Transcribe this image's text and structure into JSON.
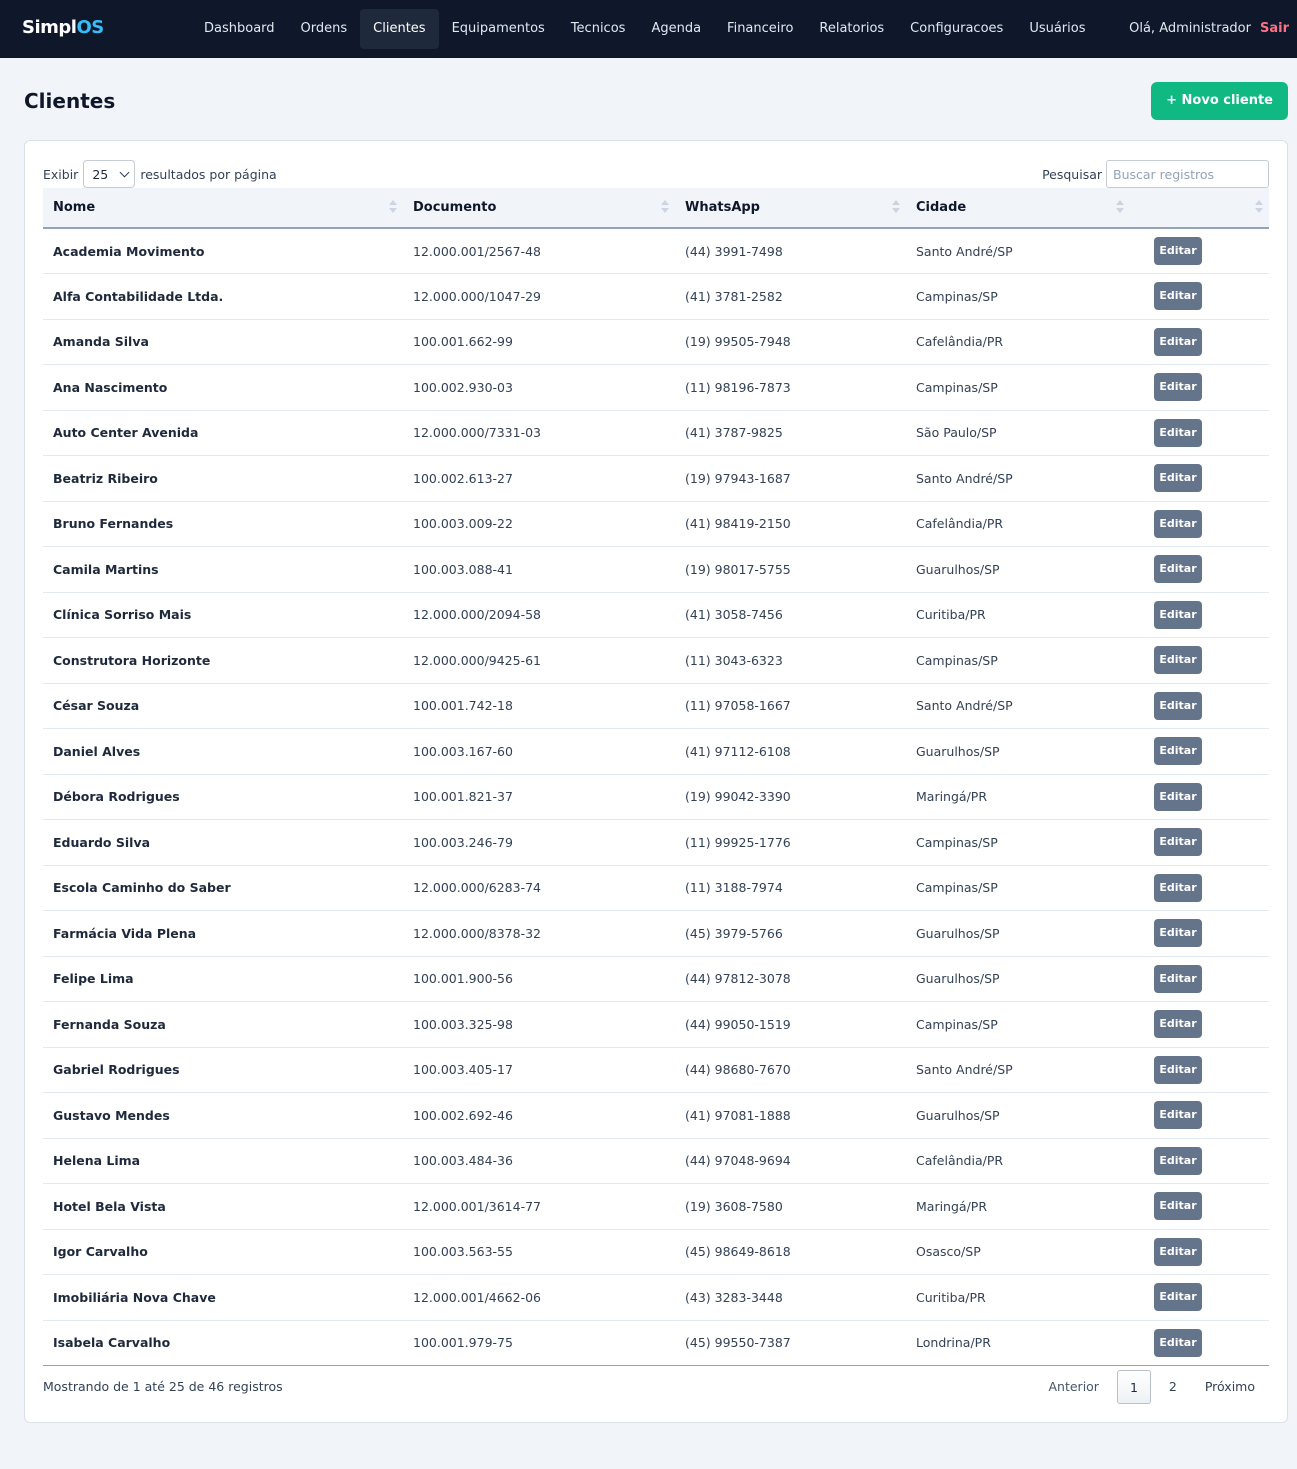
{
  "app": {
    "brand_main": "Simpl",
    "brand_accent": "OS"
  },
  "nav": {
    "items": [
      "Dashboard",
      "Ordens",
      "Clientes",
      "Equipamentos",
      "Tecnicos",
      "Agenda",
      "Financeiro",
      "Relatorios",
      "Configuracoes",
      "Usuários"
    ],
    "active": "Clientes"
  },
  "user": {
    "greeting": "Olá, Administrador",
    "logout": "Sair"
  },
  "page": {
    "title": "Clientes",
    "new_button": "+ Novo cliente"
  },
  "table_controls": {
    "show_label": "Exibir",
    "page_size": "25",
    "per_page_label": "resultados por página",
    "search_label": "Pesquisar",
    "search_placeholder": "Buscar registros",
    "search_value": ""
  },
  "table": {
    "columns": [
      "Nome",
      "Documento",
      "WhatsApp",
      "Cidade",
      ""
    ],
    "edit_label": "Editar",
    "rows": [
      [
        "Academia Movimento",
        "12.000.001/2567-48",
        "(44) 3991-7498",
        "Santo André/SP"
      ],
      [
        "Alfa Contabilidade Ltda.",
        "12.000.000/1047-29",
        "(41) 3781-2582",
        "Campinas/SP"
      ],
      [
        "Amanda Silva",
        "100.001.662-99",
        "(19) 99505-7948",
        "Cafelândia/PR"
      ],
      [
        "Ana Nascimento",
        "100.002.930-03",
        "(11) 98196-7873",
        "Campinas/SP"
      ],
      [
        "Auto Center Avenida",
        "12.000.000/7331-03",
        "(41) 3787-9825",
        "São Paulo/SP"
      ],
      [
        "Beatriz Ribeiro",
        "100.002.613-27",
        "(19) 97943-1687",
        "Santo André/SP"
      ],
      [
        "Bruno Fernandes",
        "100.003.009-22",
        "(41) 98419-2150",
        "Cafelândia/PR"
      ],
      [
        "Camila Martins",
        "100.003.088-41",
        "(19) 98017-5755",
        "Guarulhos/SP"
      ],
      [
        "Clínica Sorriso Mais",
        "12.000.000/2094-58",
        "(41) 3058-7456",
        "Curitiba/PR"
      ],
      [
        "Construtora Horizonte",
        "12.000.000/9425-61",
        "(11) 3043-6323",
        "Campinas/SP"
      ],
      [
        "César Souza",
        "100.001.742-18",
        "(11) 97058-1667",
        "Santo André/SP"
      ],
      [
        "Daniel Alves",
        "100.003.167-60",
        "(41) 97112-6108",
        "Guarulhos/SP"
      ],
      [
        "Débora Rodrigues",
        "100.001.821-37",
        "(19) 99042-3390",
        "Maringá/PR"
      ],
      [
        "Eduardo Silva",
        "100.003.246-79",
        "(11) 99925-1776",
        "Campinas/SP"
      ],
      [
        "Escola Caminho do Saber",
        "12.000.000/6283-74",
        "(11) 3188-7974",
        "Campinas/SP"
      ],
      [
        "Farmácia Vida Plena",
        "12.000.000/8378-32",
        "(45) 3979-5766",
        "Guarulhos/SP"
      ],
      [
        "Felipe Lima",
        "100.001.900-56",
        "(44) 97812-3078",
        "Guarulhos/SP"
      ],
      [
        "Fernanda Souza",
        "100.003.325-98",
        "(44) 99050-1519",
        "Campinas/SP"
      ],
      [
        "Gabriel Rodrigues",
        "100.003.405-17",
        "(44) 98680-7670",
        "Santo André/SP"
      ],
      [
        "Gustavo Mendes",
        "100.002.692-46",
        "(41) 97081-1888",
        "Guarulhos/SP"
      ],
      [
        "Helena Lima",
        "100.003.484-36",
        "(44) 97048-9694",
        "Cafelândia/PR"
      ],
      [
        "Hotel Bela Vista",
        "12.000.001/3614-77",
        "(19) 3608-7580",
        "Maringá/PR"
      ],
      [
        "Igor Carvalho",
        "100.003.563-55",
        "(45) 98649-8618",
        "Osasco/SP"
      ],
      [
        "Imobiliária Nova Chave",
        "12.000.001/4662-06",
        "(43) 3283-3448",
        "Curitiba/PR"
      ],
      [
        "Isabela Carvalho",
        "100.001.979-75",
        "(45) 99550-7387",
        "Londrina/PR"
      ]
    ]
  },
  "footer": {
    "info": "Mostrando de 1 até 25 de 46 registros",
    "prev": "Anterior",
    "pages": [
      "1",
      "2"
    ],
    "current_page": "1",
    "next": "Próximo"
  },
  "colors": {
    "topbar": "#0f172a",
    "brand_accent": "#38bdf8",
    "primary_button": "#10b981",
    "edit_button": "#64748b",
    "logout": "#fb7185"
  }
}
